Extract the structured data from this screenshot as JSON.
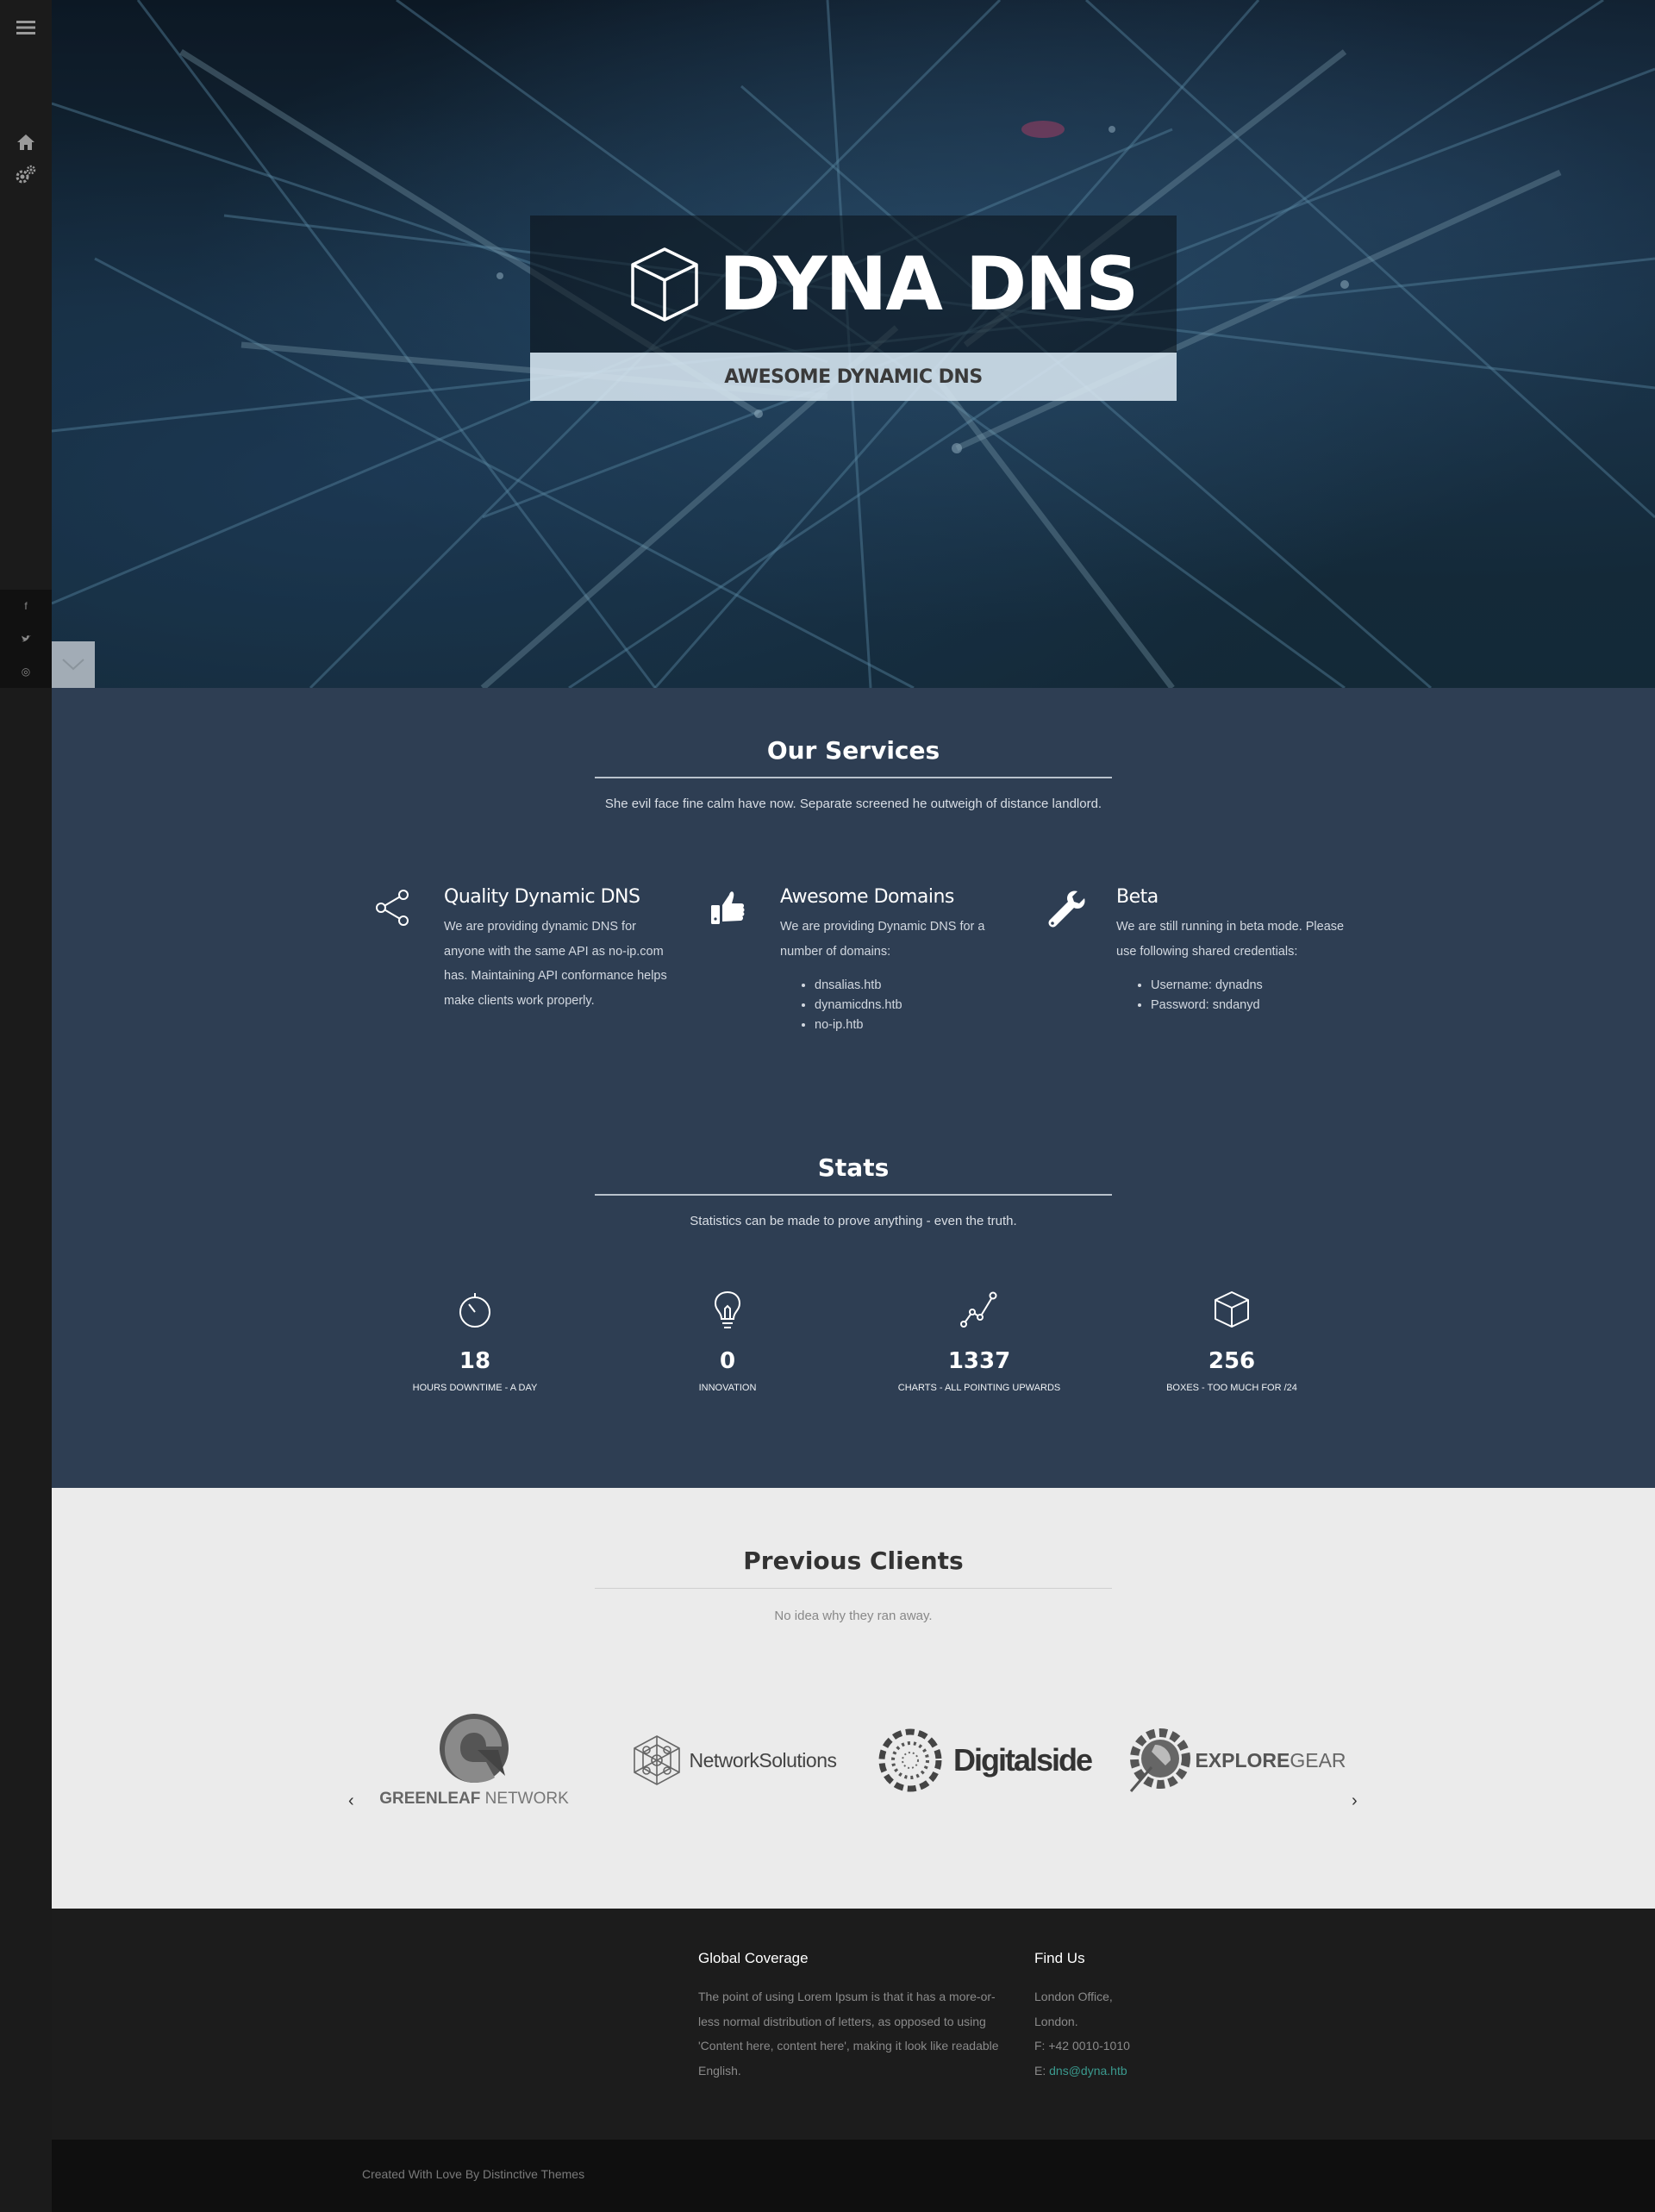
{
  "sidebar": {
    "menu_icon": "hamburger-icon",
    "nav": [
      {
        "name": "home-icon"
      },
      {
        "name": "gears-icon"
      }
    ],
    "social": [
      {
        "name": "facebook-icon",
        "glyph": "f"
      },
      {
        "name": "twitter-icon",
        "glyph": "✓"
      },
      {
        "name": "dribbble-icon",
        "glyph": "◎"
      }
    ]
  },
  "hero": {
    "title": "DYNA DNS",
    "subtitle": "AWESOME DYNAMIC DNS",
    "logo_icon": "cube-icon",
    "scroll_icon": "chevron-down-icon"
  },
  "services": {
    "title": "Our Services",
    "subtitle": "She evil face fine calm have now. Separate screened he outweigh of distance landlord.",
    "items": [
      {
        "icon": "share-icon",
        "title": "Quality Dynamic DNS",
        "text": "We are providing dynamic DNS for anyone with the same API as no-ip.com has. Maintaining API conformance helps make clients work properly."
      },
      {
        "icon": "thumbs-up-icon",
        "title": "Awesome Domains",
        "text": "We are providing Dynamic DNS for a number of domains:",
        "list": [
          "dnsalias.htb",
          "dynamicdns.htb",
          "no-ip.htb"
        ]
      },
      {
        "icon": "wrench-icon",
        "title": "Beta",
        "text": "We are still running in beta mode. Please use following shared credentials:",
        "list": [
          "Username: dynadns",
          "Password: sndanyd"
        ]
      }
    ]
  },
  "stats": {
    "title": "Stats",
    "subtitle": "Statistics can be made to prove anything - even the truth.",
    "items": [
      {
        "icon": "stopwatch-icon",
        "value": "18",
        "label": "HOURS DOWNTIME - A DAY"
      },
      {
        "icon": "lightbulb-icon",
        "value": "0",
        "label": "INNOVATION"
      },
      {
        "icon": "chart-line-icon",
        "value": "1337",
        "label": "CHARTS - ALL POINTING UPWARDS"
      },
      {
        "icon": "box-icon",
        "value": "256",
        "label": "BOXES - TOO MUCH FOR /24"
      }
    ]
  },
  "clients": {
    "title": "Previous Clients",
    "subtitle": "No idea why they ran away.",
    "logos": [
      {
        "name": "greenleaf-network-logo",
        "text_a": "GREENLEAF",
        "text_b": " NETWORK"
      },
      {
        "name": "networksolutions-logo",
        "text": "NetworkSolutions"
      },
      {
        "name": "digitalside-logo",
        "text": "Digitalside"
      },
      {
        "name": "exploregear-logo",
        "text_a": "EXPLORE",
        "text_b": "GEAR"
      }
    ],
    "prev_arrow": "‹",
    "next_arrow": "›"
  },
  "footer": {
    "coverage_title": "Global Coverage",
    "coverage_text": "The point of using Lorem Ipsum is that it has a more-or-less normal distribution of letters, as opposed to using 'Content here, content here', making it look like readable English.",
    "find_title": "Find Us",
    "address_1": "London Office,",
    "address_2": "London.",
    "phone": "F: +42 0010-1010",
    "email_label": "E: ",
    "email": "dns@dyna.htb",
    "credit": "Created With Love By Distinctive Themes"
  }
}
